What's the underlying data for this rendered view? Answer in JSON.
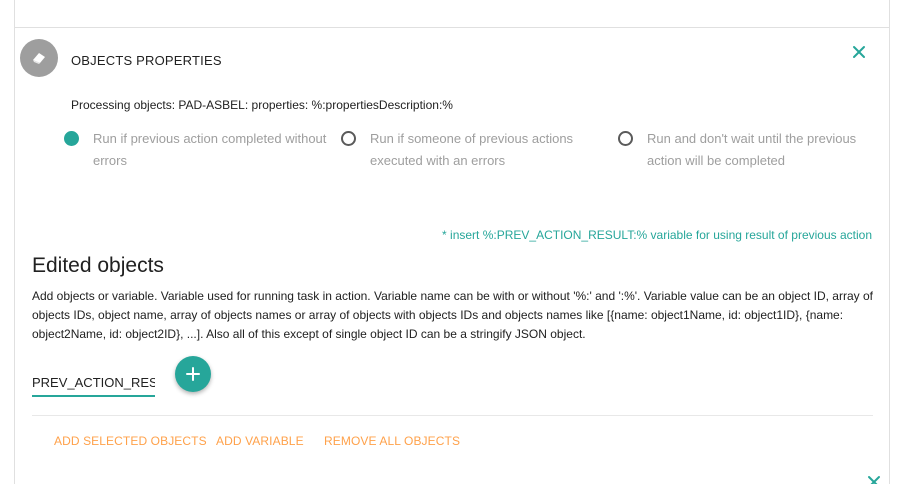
{
  "action": {
    "title": "OBJECTS PROPERTIES",
    "description": "Processing objects: PAD-ASBEL: properties: %:propertiesDescription:%",
    "run_options": [
      {
        "label_line1": "Run if previous action completed without",
        "label_line2": "errors",
        "checked": true
      },
      {
        "label_line1": "Run if someone of previous actions",
        "label_line2": "executed with an errors",
        "checked": false
      },
      {
        "label_line1": "Run and don't wait until the previous",
        "label_line2": "action will be completed",
        "checked": false
      }
    ]
  },
  "edit": {
    "hint": "* insert %:PREV_ACTION_RESULT:% variable for using result of previous action",
    "title": "Edited objects",
    "description": "Add objects or variable. Variable used for running task in action. Variable name can be with or without '%:' and ':%'. Variable value can be an object ID, array of objects IDs, object name, array of objects names or array of objects with objects IDs and objects names like [{name: object1Name, id: object1ID}, {name: object2Name, id: object2ID}, ...]. Also all of this except of single object ID can be a stringify JSON object.",
    "variable_value": "PREV_ACTION_RESULT",
    "buttons": {
      "add_selected": "ADD SELECTED OBJECTS",
      "add_variable": "ADD VARIABLE",
      "remove_all": "REMOVE ALL OBJECTS"
    }
  },
  "colors": {
    "accent": "#26a69a",
    "orange": "#ffa14a",
    "muted": "#9e9e9e"
  },
  "icons": {
    "avatar": "eraser-icon",
    "close": "close-icon",
    "add": "plus-icon"
  }
}
